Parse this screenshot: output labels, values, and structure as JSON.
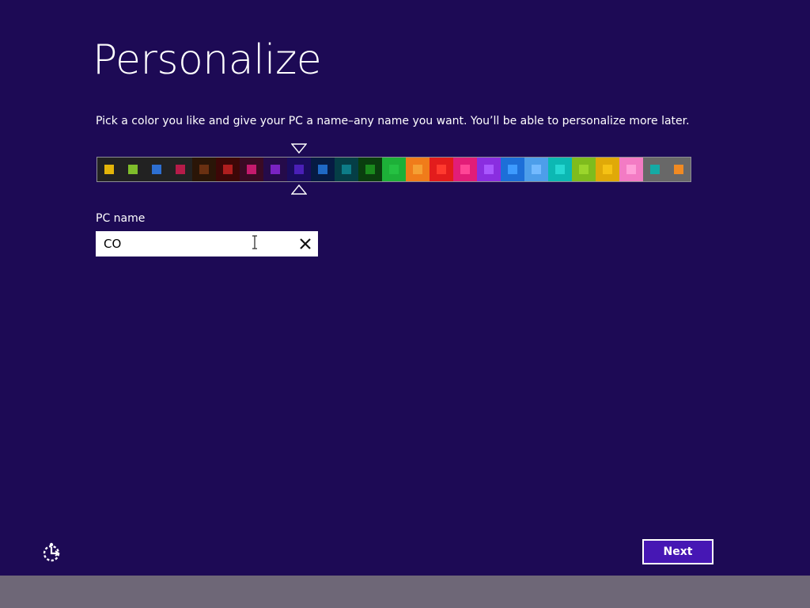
{
  "page": {
    "title": "Personalize",
    "description": "Pick a color you like and give your PC a name–any name you want. You’ll be able to personalize more later."
  },
  "colors": {
    "selected_index": 8,
    "swatches": [
      {
        "bg": "#222222",
        "chip": "#e3b409"
      },
      {
        "bg": "#222222",
        "chip": "#7fbd2b"
      },
      {
        "bg": "#222222",
        "chip": "#2d6fd1"
      },
      {
        "bg": "#222222",
        "chip": "#b51b49"
      },
      {
        "bg": "#2a1507",
        "chip": "#6a3011"
      },
      {
        "bg": "#3d0707",
        "chip": "#b01e1e"
      },
      {
        "bg": "#3a0a24",
        "chip": "#c41a6d"
      },
      {
        "bg": "#250b4a",
        "chip": "#7a23c2"
      },
      {
        "bg": "#1a0c5e",
        "chip": "#4a1fb7"
      },
      {
        "bg": "#061b43",
        "chip": "#1f69c4"
      },
      {
        "bg": "#053e46",
        "chip": "#0d7c87"
      },
      {
        "bg": "#0a3e0e",
        "chip": "#1a8a1d"
      },
      {
        "bg": "#1db038",
        "chip": "#25c142"
      },
      {
        "bg": "#f07c1a",
        "chip": "#f5a033"
      },
      {
        "bg": "#e31c1c",
        "chip": "#ff3a2e"
      },
      {
        "bg": "#e21d78",
        "chip": "#ff4596"
      },
      {
        "bg": "#8a2ee0",
        "chip": "#a957ff"
      },
      {
        "bg": "#1d6fd8",
        "chip": "#3d9bff"
      },
      {
        "bg": "#4d9eea",
        "chip": "#73baff"
      },
      {
        "bg": "#0cb8b3",
        "chip": "#26d8d2"
      },
      {
        "bg": "#7fbc1d",
        "chip": "#9bd62c"
      },
      {
        "bg": "#e0a908",
        "chip": "#f5c214"
      },
      {
        "bg": "#f37bc4",
        "chip": "#ff9fd8"
      },
      {
        "bg": "#686868",
        "chip": "#14aaa5"
      },
      {
        "bg": "#686868",
        "chip": "#f08a23"
      }
    ]
  },
  "pc_name": {
    "label": "PC name",
    "value": "CO",
    "clear_icon": "close-icon"
  },
  "footer": {
    "ease_of_access_icon": "ease-of-access-icon",
    "next_label": "Next"
  },
  "theme": {
    "background": "#1d0a55",
    "accent": "#4617b4",
    "taskbar": "#6e6777"
  }
}
